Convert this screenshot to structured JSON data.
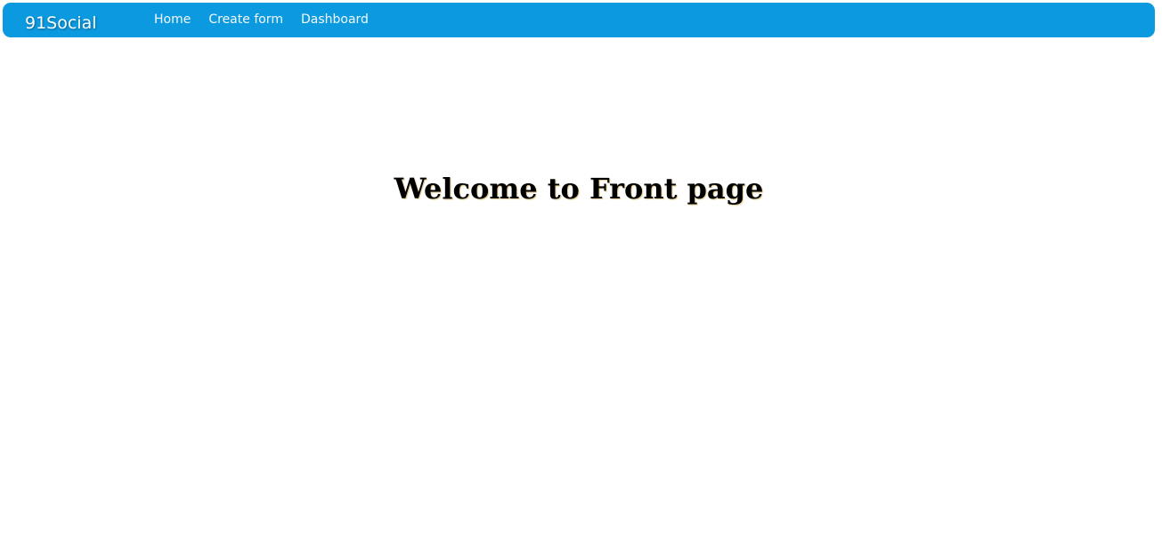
{
  "navbar": {
    "brand": "91Social",
    "links": [
      {
        "label": "Home"
      },
      {
        "label": "Create form"
      },
      {
        "label": "Dashboard"
      }
    ],
    "colors": {
      "background": "#0b99e0",
      "text": "#ffffff"
    }
  },
  "main": {
    "title": "Welcome to Front page"
  }
}
